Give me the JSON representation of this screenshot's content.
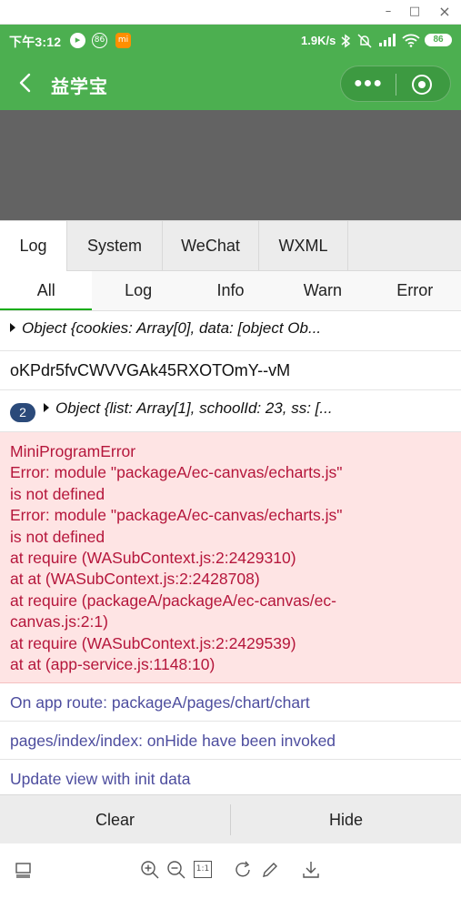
{
  "window": {
    "minimize": "–",
    "maximize": "□",
    "close": "×"
  },
  "status_bar": {
    "time": "下午3:12",
    "badge_circle": "86",
    "badge_orange": "mi",
    "network_speed": "1.9K/s",
    "battery": "86",
    "icons": [
      "bilibili-icon",
      "badge-86-icon",
      "mi-app-icon",
      "bluetooth-icon",
      "mute-icon",
      "signal-icon",
      "wifi-icon",
      "battery-icon"
    ]
  },
  "nav": {
    "title": "益学宝",
    "back_icon": "chevron-left-icon",
    "more_icon": "more-dots-icon",
    "close_icon": "target-close-icon"
  },
  "console": {
    "tabs": [
      "Log",
      "System",
      "WeChat",
      "WXML"
    ],
    "active_tab": "Log",
    "filters": [
      "All",
      "Log",
      "Info",
      "Warn",
      "Error"
    ],
    "active_filter": "All",
    "entries": {
      "e1": "Object {cookies: Array[0], data: [object Ob...",
      "e2": "oKPdr5fvCWVVGAk45RXOTOmY--vM",
      "e3_count": "2",
      "e3": "Object {list: Array[1], schoolId: 23, ss: [...",
      "error_lines": [
        "MiniProgramError",
        "Error: module \"packageA/ec-canvas/echarts.js\"",
        "is not defined",
        "Error: module \"packageA/ec-canvas/echarts.js\"",
        "is not defined",
        "at require (WASubContext.js:2:2429310)",
        "at at (WASubContext.js:2:2428708)",
        "at require (packageA/packageA/ec-canvas/ec-",
        "canvas.js:2:1)",
        "at require (WASubContext.js:2:2429539)",
        "at at (app-service.js:1148:10)"
      ],
      "info1": "On app route: packageA/pages/chart/chart",
      "info2": "pages/index/index: onHide have been invoked",
      "info3": "Update view with init data"
    },
    "buttons": {
      "clear": "Clear",
      "hide": "Hide"
    }
  },
  "toolbar": {
    "icons": [
      "device-frame-icon",
      "zoom-in-icon",
      "zoom-out-icon",
      "actual-size-icon",
      "rotate-icon",
      "edit-icon",
      "download-icon"
    ],
    "actual_size": "1:1"
  },
  "colors": {
    "brand_green": "#4caf50",
    "error_bg": "#fee4e4",
    "error_text": "#b5163b",
    "info_text": "#4d4d9e"
  }
}
